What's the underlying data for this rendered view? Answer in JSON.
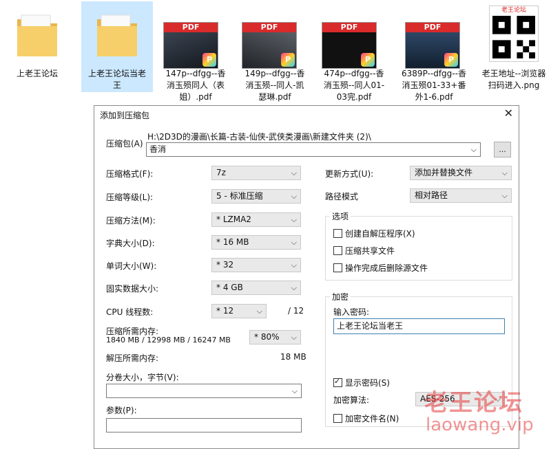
{
  "explorer": {
    "items": [
      {
        "caption": "上老王论坛",
        "type": "folder"
      },
      {
        "caption": "上老王论坛当老王",
        "type": "folder"
      },
      {
        "caption": "147p--dfgg--香消玉殒同人（表姐）.pdf",
        "type": "pdf"
      },
      {
        "caption": "149p--dfgg--香消玉殒--同人-凯瑟琳.pdf",
        "type": "pdf"
      },
      {
        "caption": "474p--dfgg--香消玉殒--同人01-03完.pdf",
        "type": "pdf"
      },
      {
        "caption": "6389P--dfgg--香消玉殒01-33+番外1-6.pdf",
        "type": "pdf"
      },
      {
        "caption": "老王地址--浏览器扫码进入.png",
        "type": "image"
      }
    ],
    "pdf_label": "PDF",
    "qr_header": "老王论坛"
  },
  "dialog": {
    "title": "添加到压缩包",
    "close_glyph": "✕",
    "archive_label": "压缩包(A)",
    "archive_path": "H:\\2D3D的漫画\\长篇-古装-仙侠-武侠类漫画\\新建文件夹 (2)\\",
    "archive_name": "香消",
    "browse_label": "...",
    "left": {
      "format_label": "压缩格式(F):",
      "format_value": "7z",
      "level_label": "压缩等级(L):",
      "level_value": "5 - 标准压缩",
      "method_label": "压缩方法(M):",
      "method_value": "*  LZMA2",
      "dict_label": "字典大小(D):",
      "dict_value": "*  16 MB",
      "word_label": "单词大小(W):",
      "word_value": "*  32",
      "solid_label": "固实数据大小:",
      "solid_value": "*  4 GB",
      "cpu_label": "CPU 线程数:",
      "cpu_value": "*  12",
      "cpu_total": "/ 12",
      "mem_label": "压缩所需内存:",
      "mem_detail": "1840 MB / 12998 MB / 16247 MB",
      "mem_value": "*  80%",
      "decomp_label": "解压所需内存:",
      "decomp_value": "18 MB",
      "split_label": "分卷大小，字节(V):",
      "params_label": "参数(P):"
    },
    "right": {
      "update_label": "更新方式(U):",
      "update_value": "添加并替换文件",
      "path_label": "路径模式",
      "path_value": "相对路径",
      "options_title": "选项",
      "opt_sfx": "创建自解压程序(X)",
      "opt_shared": "压缩共享文件",
      "opt_delete": "操作完成后删除源文件",
      "enc_title": "加密",
      "pwd_label": "输入密码:",
      "pwd_value": "上老王论坛当老王",
      "show_pwd": "显示密码(S)",
      "alg_label": "加密算法:",
      "alg_value": "AES-256",
      "enc_names": "加密文件名(N)"
    }
  },
  "watermark": {
    "text": "老王论坛",
    "url": "laowang.vip"
  }
}
